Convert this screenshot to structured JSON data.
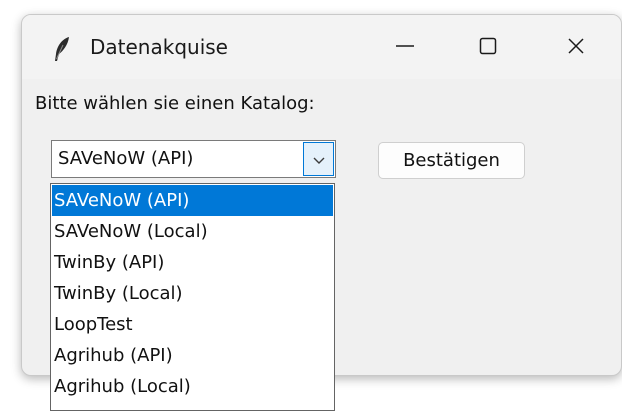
{
  "window": {
    "title": "Datenakquise",
    "icon": "feather-icon",
    "controls": {
      "minimize_icon": "minimize-icon",
      "maximize_icon": "maximize-icon",
      "close_icon": "close-icon"
    }
  },
  "form": {
    "prompt": "Bitte wählen sie einen Katalog:",
    "catalog_combo": {
      "value": "SAVeNoW (API)",
      "arrow_icon": "chevron-down-icon"
    },
    "confirm_label": "Bestätigen"
  },
  "dropdown": {
    "options": [
      "SAVeNoW (API)",
      "SAVeNoW (Local)",
      "TwinBy (API)",
      "TwinBy (Local)",
      "LoopTest",
      "Agrihub (API)",
      "Agrihub (Local)"
    ],
    "selected": "SAVeNoW (API)"
  },
  "colors": {
    "selection": "#0078d7",
    "window_bg": "#f0f0f0",
    "titlebar_bg": "#f3f3f3"
  }
}
